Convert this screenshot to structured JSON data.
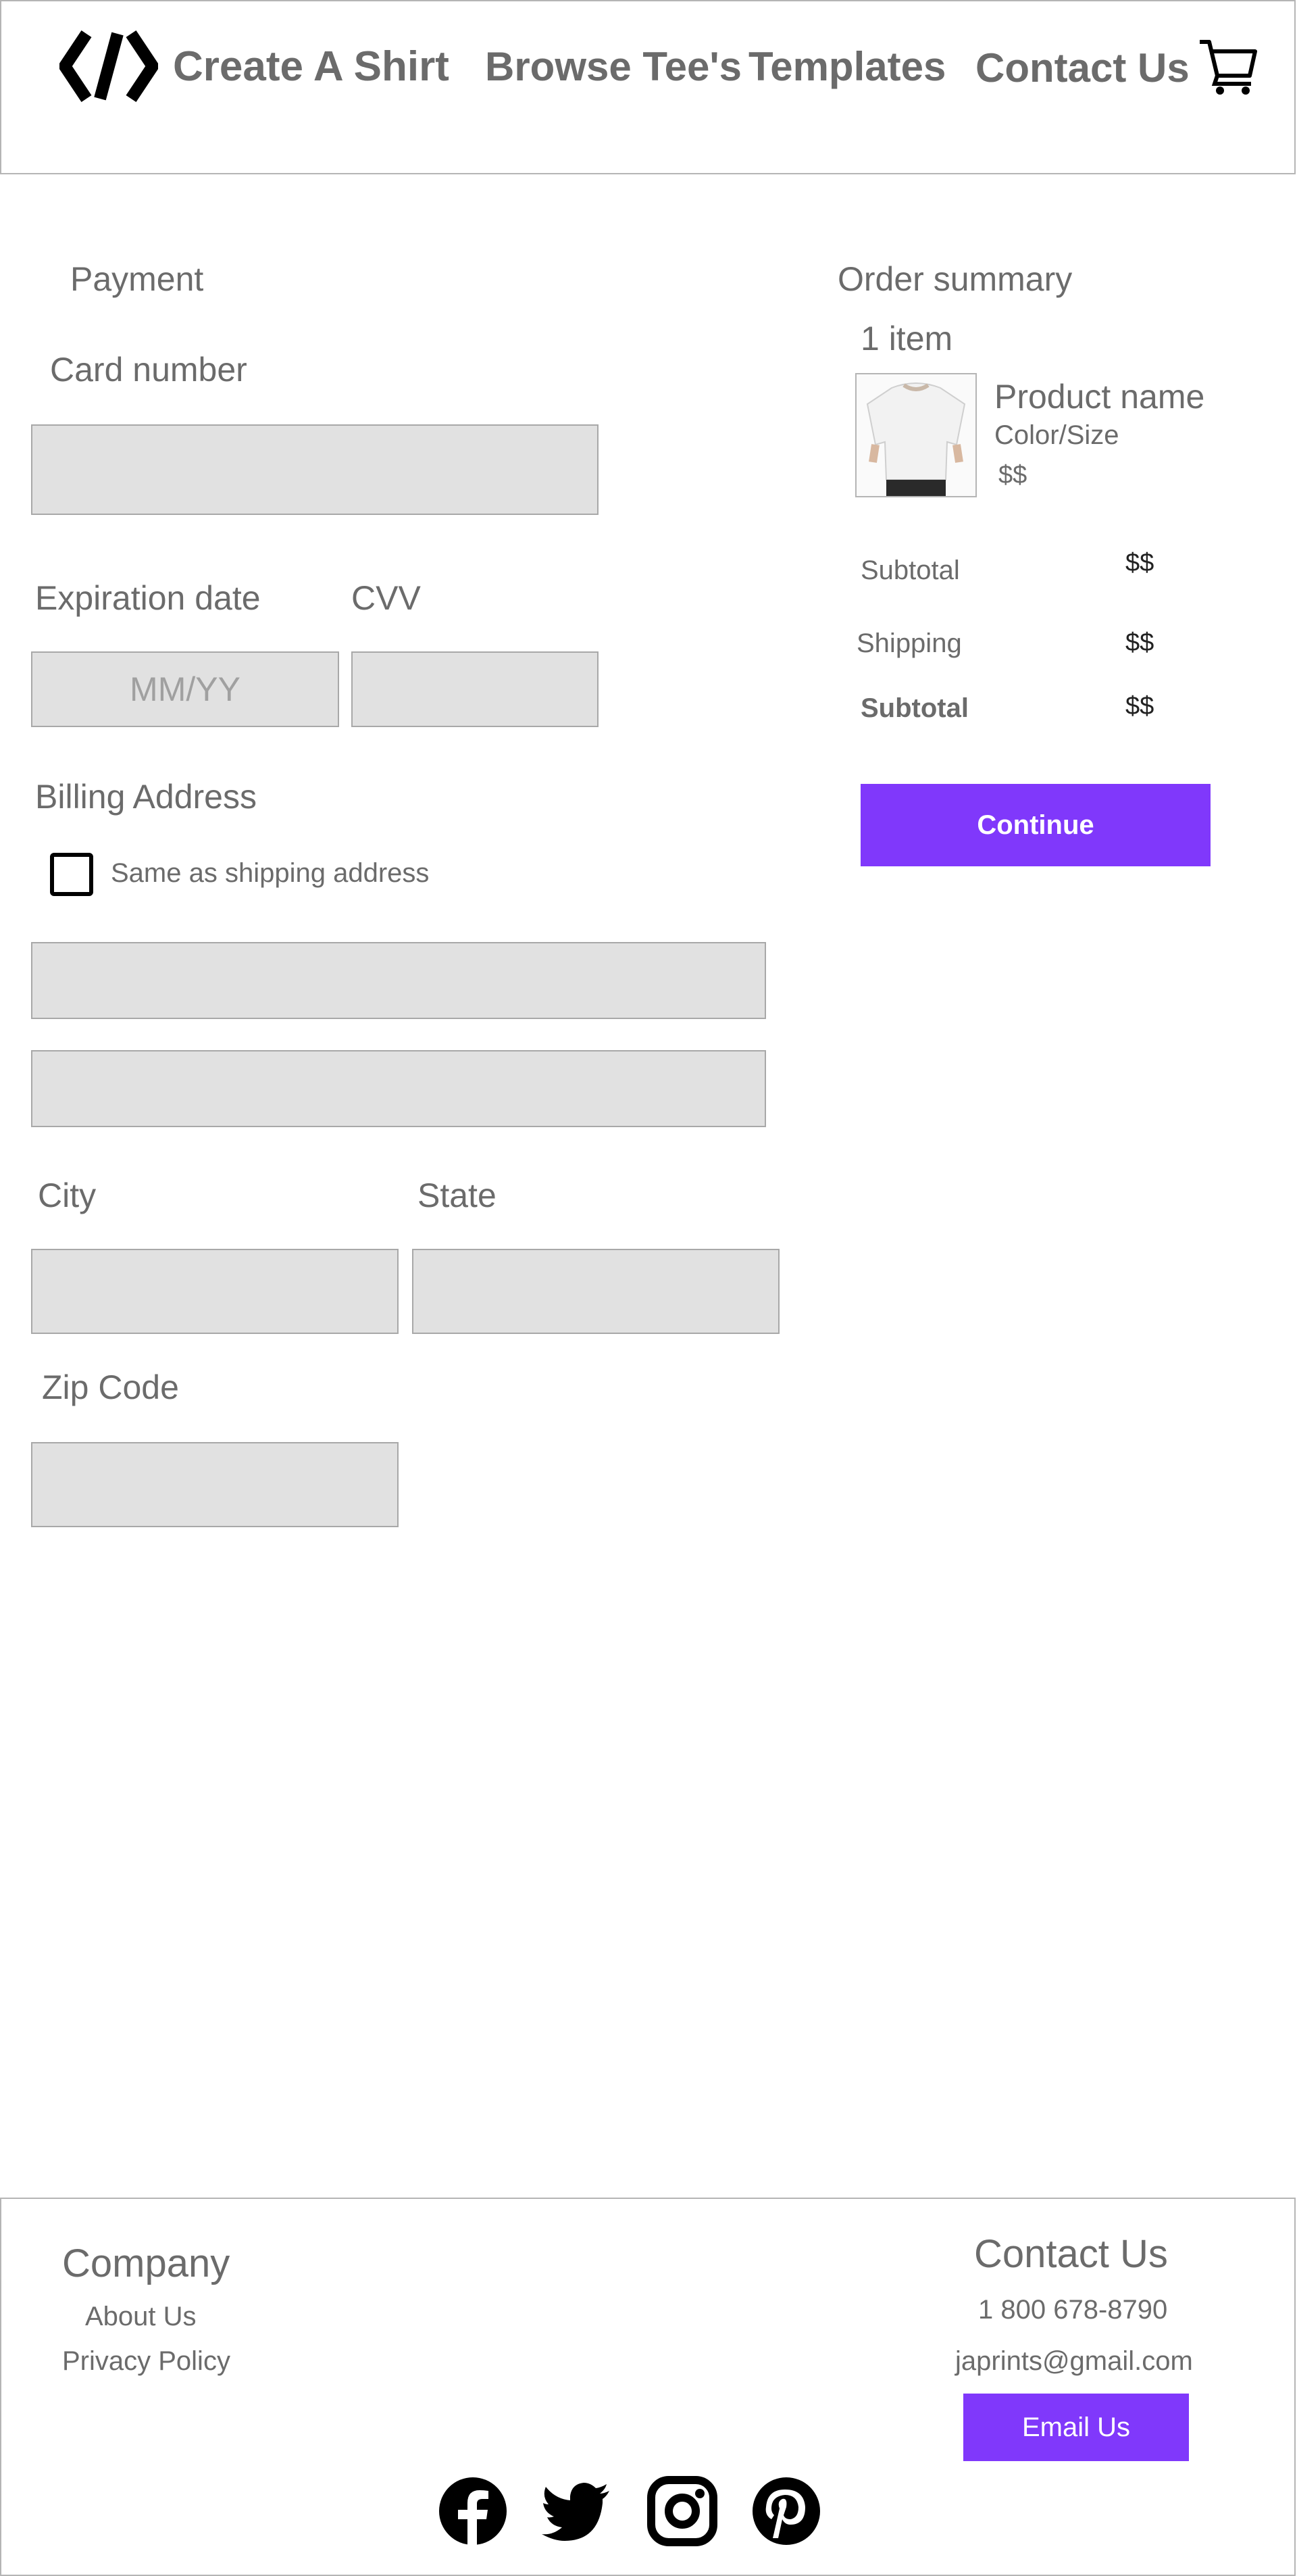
{
  "header": {
    "brand_text": "Create A Shirt",
    "brand_icon": "code-brackets-logo-icon",
    "nav": [
      "Browse Tee's",
      "Templates",
      "Contact Us"
    ],
    "cart_icon": "shopping-cart-icon"
  },
  "payment": {
    "title": "Payment",
    "card_number_label": "Card number",
    "card_number_value": "",
    "expiration_label": "Expiration date",
    "expiration_placeholder": "MM/YY",
    "cvv_label": "CVV",
    "cvv_value": "",
    "billing_title": "Billing Address",
    "same_as_shipping_label": "Same as shipping address",
    "same_as_shipping_checked": false,
    "address_line1_value": "",
    "address_line2_value": "",
    "city_label": "City",
    "state_label": "State",
    "zip_label": "Zip Code"
  },
  "summary": {
    "title": "Order summary",
    "item_count": "1 item",
    "product_name": "Product name",
    "product_variant": "Color/Size",
    "product_price": "$$",
    "rows": [
      {
        "label": "Subtotal",
        "value": "$$"
      },
      {
        "label": "Shipping",
        "value": "$$"
      },
      {
        "label": "Subtotal",
        "value": "$$"
      }
    ],
    "continue_label": "Continue",
    "accent_color": "#8038fb"
  },
  "footer": {
    "company_title": "Company",
    "company_links": [
      "About Us",
      "Privacy Policy"
    ],
    "contact_title": "Contact Us",
    "phone": "1 800 678-8790",
    "email": "japrints@gmail.com",
    "email_button_label": "Email Us",
    "social_icons": [
      "facebook-icon",
      "twitter-icon",
      "instagram-icon",
      "pinterest-icon"
    ]
  }
}
